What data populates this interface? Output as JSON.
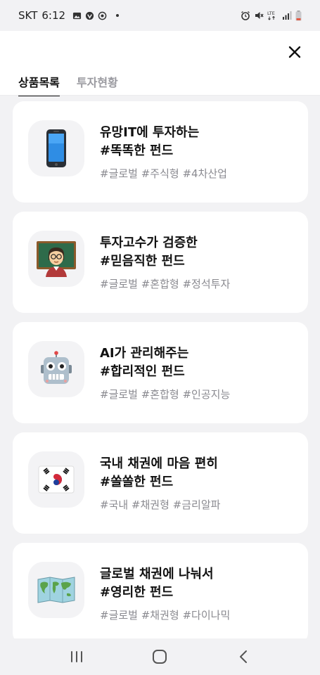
{
  "status_bar": {
    "carrier": "SKT",
    "time": "6:12",
    "lte_label": "LTE",
    "battery_color": "#e5533c"
  },
  "header": {
    "tabs": [
      {
        "label": "상품목록",
        "active": true
      },
      {
        "label": "투자현황",
        "active": false
      }
    ]
  },
  "products": [
    {
      "icon": "mobile-phone-icon",
      "title_line1": "유망IT에 투자하는",
      "title_line2": "#똑똑한 펀드",
      "tags": "#글로벌 #주식형 #4차산업"
    },
    {
      "icon": "teacher-icon",
      "title_line1": "투자고수가 검증한",
      "title_line2": "#믿음직한 펀드",
      "tags": "#글로벌 #혼합형 #정석투자"
    },
    {
      "icon": "robot-icon",
      "title_line1": "AI가 관리해주는",
      "title_line2": "#합리적인 펀드",
      "tags": "#글로벌 #혼합형 #인공지능"
    },
    {
      "icon": "korea-flag-icon",
      "title_line1": "국내 채권에 마음 편히",
      "title_line2": "#쏠쏠한 펀드",
      "tags": "#국내 #채권형 #금리알파"
    },
    {
      "icon": "world-map-icon",
      "title_line1": "글로벌 채권에 나눠서",
      "title_line2": "#영리한 펀드",
      "tags": "#글로벌 #채권형 #다이나믹"
    }
  ],
  "colors": {
    "background": "#f2f2f4",
    "card": "#ffffff",
    "tag_text": "#8a8a90",
    "inactive_tab": "#9a9aa0"
  }
}
